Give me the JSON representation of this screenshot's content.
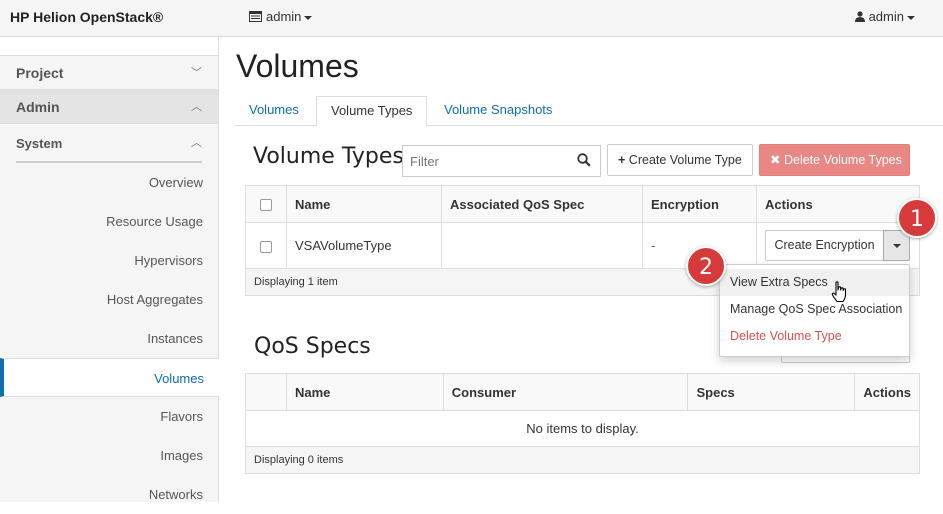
{
  "topbar": {
    "brand": "HP Helion OpenStack®",
    "project": "admin",
    "user": "admin"
  },
  "sidebar": {
    "project_label": "Project",
    "admin_label": "Admin",
    "system_label": "System",
    "items": [
      "Overview",
      "Resource Usage",
      "Hypervisors",
      "Host Aggregates",
      "Instances",
      "Volumes",
      "Flavors",
      "Images",
      "Networks"
    ],
    "active_item": "Volumes"
  },
  "main": {
    "title": "Volumes",
    "tabs": [
      "Volumes",
      "Volume Types",
      "Volume Snapshots"
    ],
    "active_tab": "Volume Types"
  },
  "volume_types": {
    "title": "Volume Types",
    "filter_placeholder": "Filter",
    "create_button": "Create Volume Type",
    "delete_button": "Delete Volume Types",
    "columns": [
      "Name",
      "Associated QoS Spec",
      "Encryption",
      "Actions"
    ],
    "rows": [
      {
        "name": "VSAVolumeType",
        "qos": "",
        "encryption": "-",
        "action": "Create Encryption"
      }
    ],
    "footer": "Displaying 1 item",
    "dropdown": [
      "View Extra Specs",
      "Manage QoS Spec Association",
      "Delete Volume Type"
    ]
  },
  "qos_specs": {
    "title": "QoS Specs",
    "columns": [
      "Name",
      "Consumer",
      "Specs",
      "Actions"
    ],
    "empty": "No items to display.",
    "footer": "Displaying 0 items"
  },
  "callouts": [
    "1",
    "2"
  ],
  "colors": {
    "accent": "#0d6eb2",
    "danger_button": "#e88784",
    "callout": "#d63a3a",
    "danger_text": "#d9534f"
  }
}
